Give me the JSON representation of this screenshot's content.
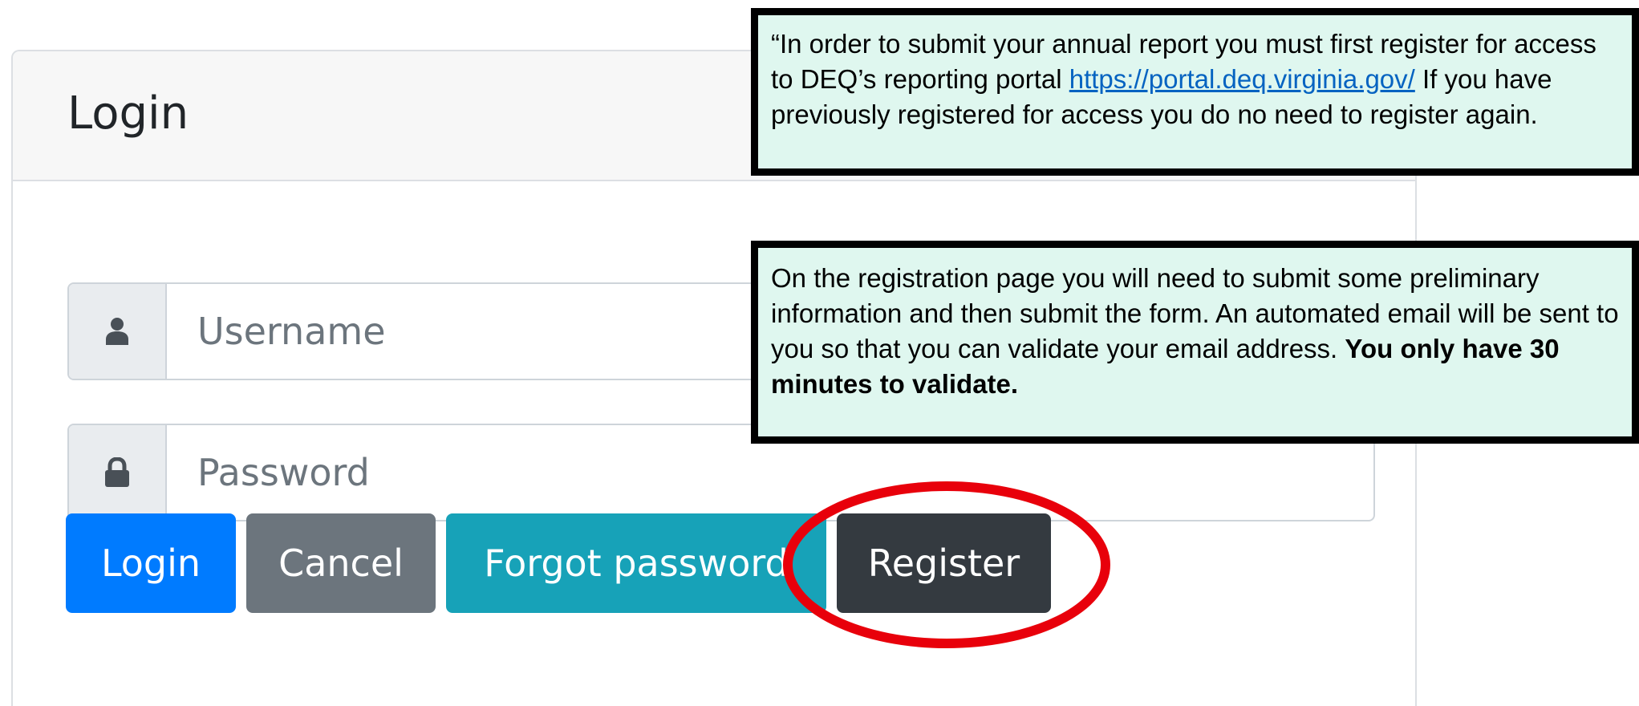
{
  "login_card": {
    "title": "Login",
    "username": {
      "placeholder": "Username",
      "icon": "user-icon"
    },
    "password": {
      "placeholder": "Password",
      "icon": "lock-icon"
    },
    "buttons": {
      "login": "Login",
      "cancel": "Cancel",
      "forgot_password": "Forgot password",
      "register": "Register"
    }
  },
  "colors": {
    "login": "#007bff",
    "cancel": "#6c757d",
    "forgot_password": "#17a2b8",
    "register": "#343a40",
    "callout_background": "#dff7ef",
    "highlight": "#e8000b"
  },
  "callouts": {
    "first": {
      "text_before_link": "“In order to submit your annual report you must first register for access to DEQ’s reporting portal ",
      "link_text": "https://portal.deq.virginia.gov/",
      "text_after_link": " If you have previously registered for access you do no need to register again."
    },
    "second": {
      "text": "On the registration page you will need to submit some preliminary information and then submit the form.  An automated email will be sent to  you so that you can validate your email address.  ",
      "bold_text": "You only have 30 minutes to validate."
    }
  }
}
